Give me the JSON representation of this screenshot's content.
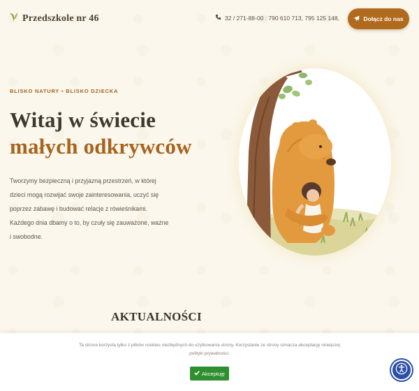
{
  "header": {
    "brand_name": "Przedszkole nr 46",
    "phone": "32 / 271-88-00 : 790 610 713, 795 125 148,",
    "cta_label": "Dołącz do nas"
  },
  "hero": {
    "eyebrow": "BLISKO NATURY • BLISKO DZIECKA",
    "title_line1": "Witaj w świecie",
    "title_line2": "małych odkrywców",
    "desc_lines": [
      "Tworzymy bezpieczną i przyjazną przestrzeń, w której",
      "dzieci mogą rozwijać swoje zainteresowania, uczyć się",
      "poprzez zabawę i budować relacje z rówieśnikami.",
      "Każdego dnia dbamy o to, by czuły się zauważone, ważne",
      "i swobodne."
    ]
  },
  "news": {
    "title": "AKTUALNOŚCI"
  },
  "cookie": {
    "line1": "Ta strona korzysta tylko z plików cookies niezbędnych do użytkowania strony. Korzystanie ze strony oznacza akceptację niniejszej",
    "line2": "polityki prywatności.",
    "accept_label": "Akceptuję"
  },
  "colors": {
    "background": "#fbf7ec",
    "accent": "#b06a1e",
    "accept_green": "#2f8f2f",
    "accessibility_blue": "#2a4fa8"
  },
  "icons": {
    "brand": "leaf-icon",
    "phone": "phone-icon",
    "cta": "paper-plane-icon",
    "accept": "check-icon",
    "accessibility": "accessibility-icon"
  }
}
